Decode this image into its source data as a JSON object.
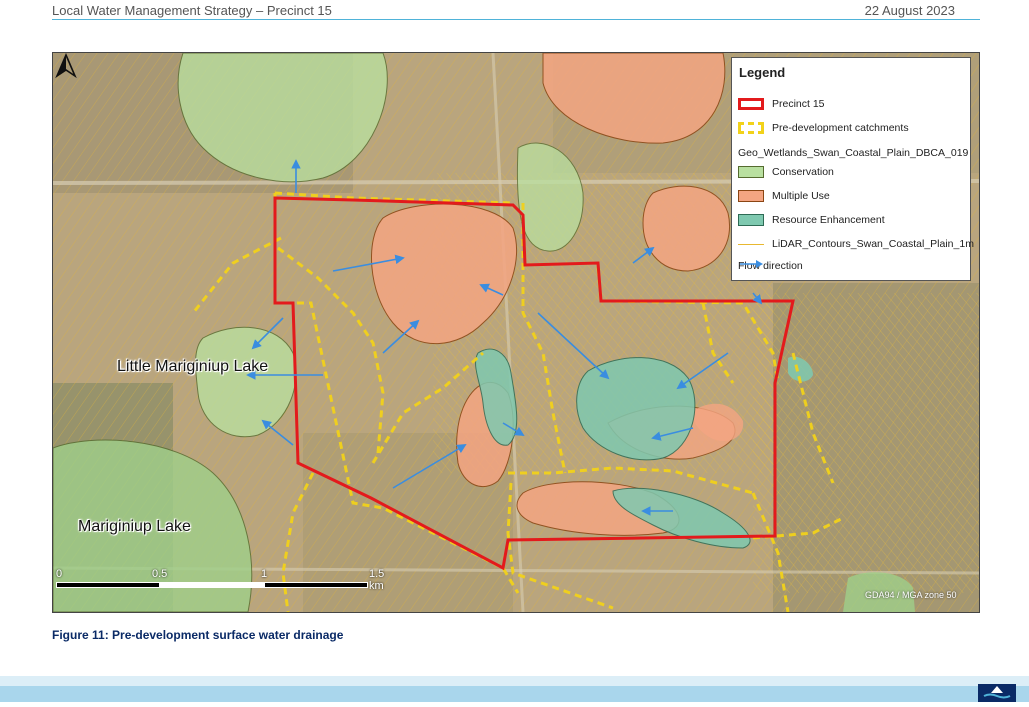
{
  "header": {
    "left_text": "Local Water Management Strategy – Precinct 15",
    "right_text": "22 August 2023"
  },
  "map": {
    "labels": {
      "lake1": "Little Mariginiup Lake",
      "lake2": "Mariginiup Lake"
    },
    "legend": {
      "title": "Legend",
      "items": [
        {
          "label": "Precinct 15",
          "color": "#e31a1c"
        },
        {
          "label": "Pre-development catchments",
          "color": "#f2d21a"
        },
        {
          "label": "Geo_Wetlands_Swan_Coastal_Plain_DBCA_019"
        },
        {
          "label": "Conservation",
          "color": "#b9e0a0"
        },
        {
          "label": "Multiple Use",
          "color": "#f4a582"
        },
        {
          "label": "Resource Enhancement",
          "color": "#7fc9b0"
        },
        {
          "label": "LiDAR_Contours_Swan_Coastal_Plain_1m",
          "color": "#e8b830"
        },
        {
          "label": "Flow direction",
          "color": "#3a8de0"
        }
      ]
    },
    "scale": {
      "ticks": [
        "0",
        "0.5",
        "1",
        "1.5 km"
      ]
    },
    "projection": "GDA94 / MGA zone 50",
    "north_symbol": "north-arrow-icon"
  },
  "caption": "Figure 11: Pre-development surface water drainage",
  "footer": {
    "logo_icon": "wave-logo-icon"
  }
}
